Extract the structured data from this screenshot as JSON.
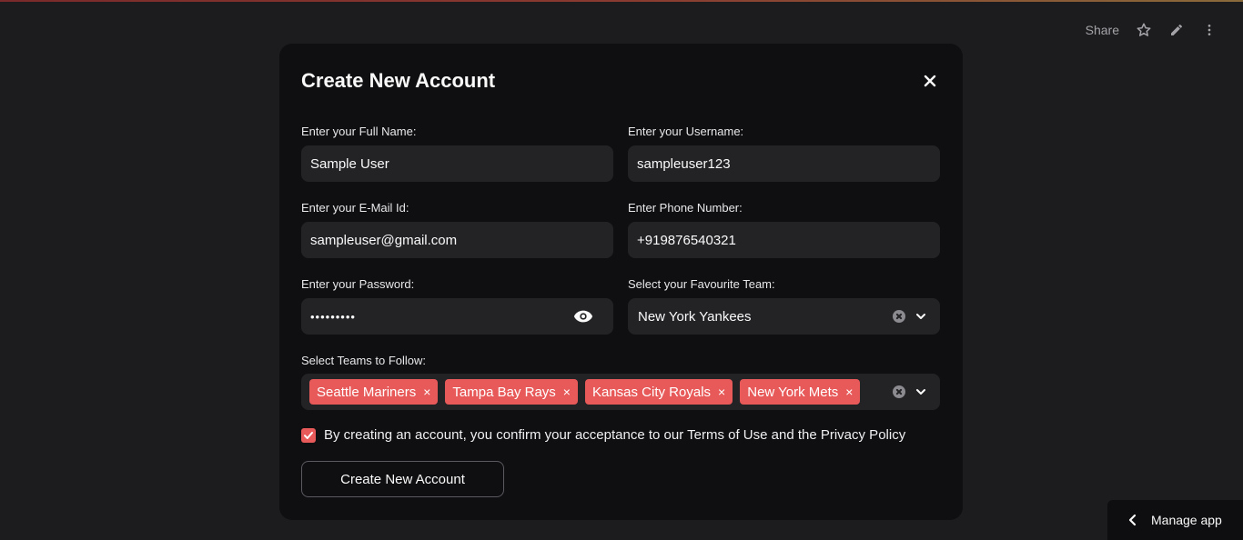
{
  "toolbar": {
    "share_label": "Share",
    "icons": [
      "star-icon",
      "pencil-icon",
      "kebab-menu-icon"
    ]
  },
  "modal": {
    "title": "Create New Account",
    "fields": {
      "full_name": {
        "label": "Enter your Full Name:",
        "value": "Sample User"
      },
      "username": {
        "label": "Enter your Username:",
        "value": "sampleuser123"
      },
      "email": {
        "label": "Enter your E-Mail Id:",
        "value": "sampleuser@gmail.com"
      },
      "phone": {
        "label": "Enter Phone Number:",
        "value": "+919876540321"
      },
      "password": {
        "label": "Enter your Password:",
        "value": "•••••••••"
      },
      "favourite_team": {
        "label": "Select your Favourite Team:",
        "value": "New York Yankees"
      }
    },
    "follow": {
      "label": "Select Teams to Follow:",
      "chips": [
        "Seattle Mariners",
        "Tampa Bay Rays",
        "Kansas City Royals",
        "New York Mets"
      ],
      "chip_remove": "×"
    },
    "consent_text": "By creating an account, you confirm your acceptance to our Terms of Use and the Privacy Policy",
    "consent_checked": true,
    "submit_label": "Create New Account"
  },
  "manage_app_label": "Manage app",
  "colors": {
    "accent": "#e85a5a",
    "background": "#1c1c1e",
    "modal_bg": "#0f0f11",
    "input_bg": "#232326"
  }
}
